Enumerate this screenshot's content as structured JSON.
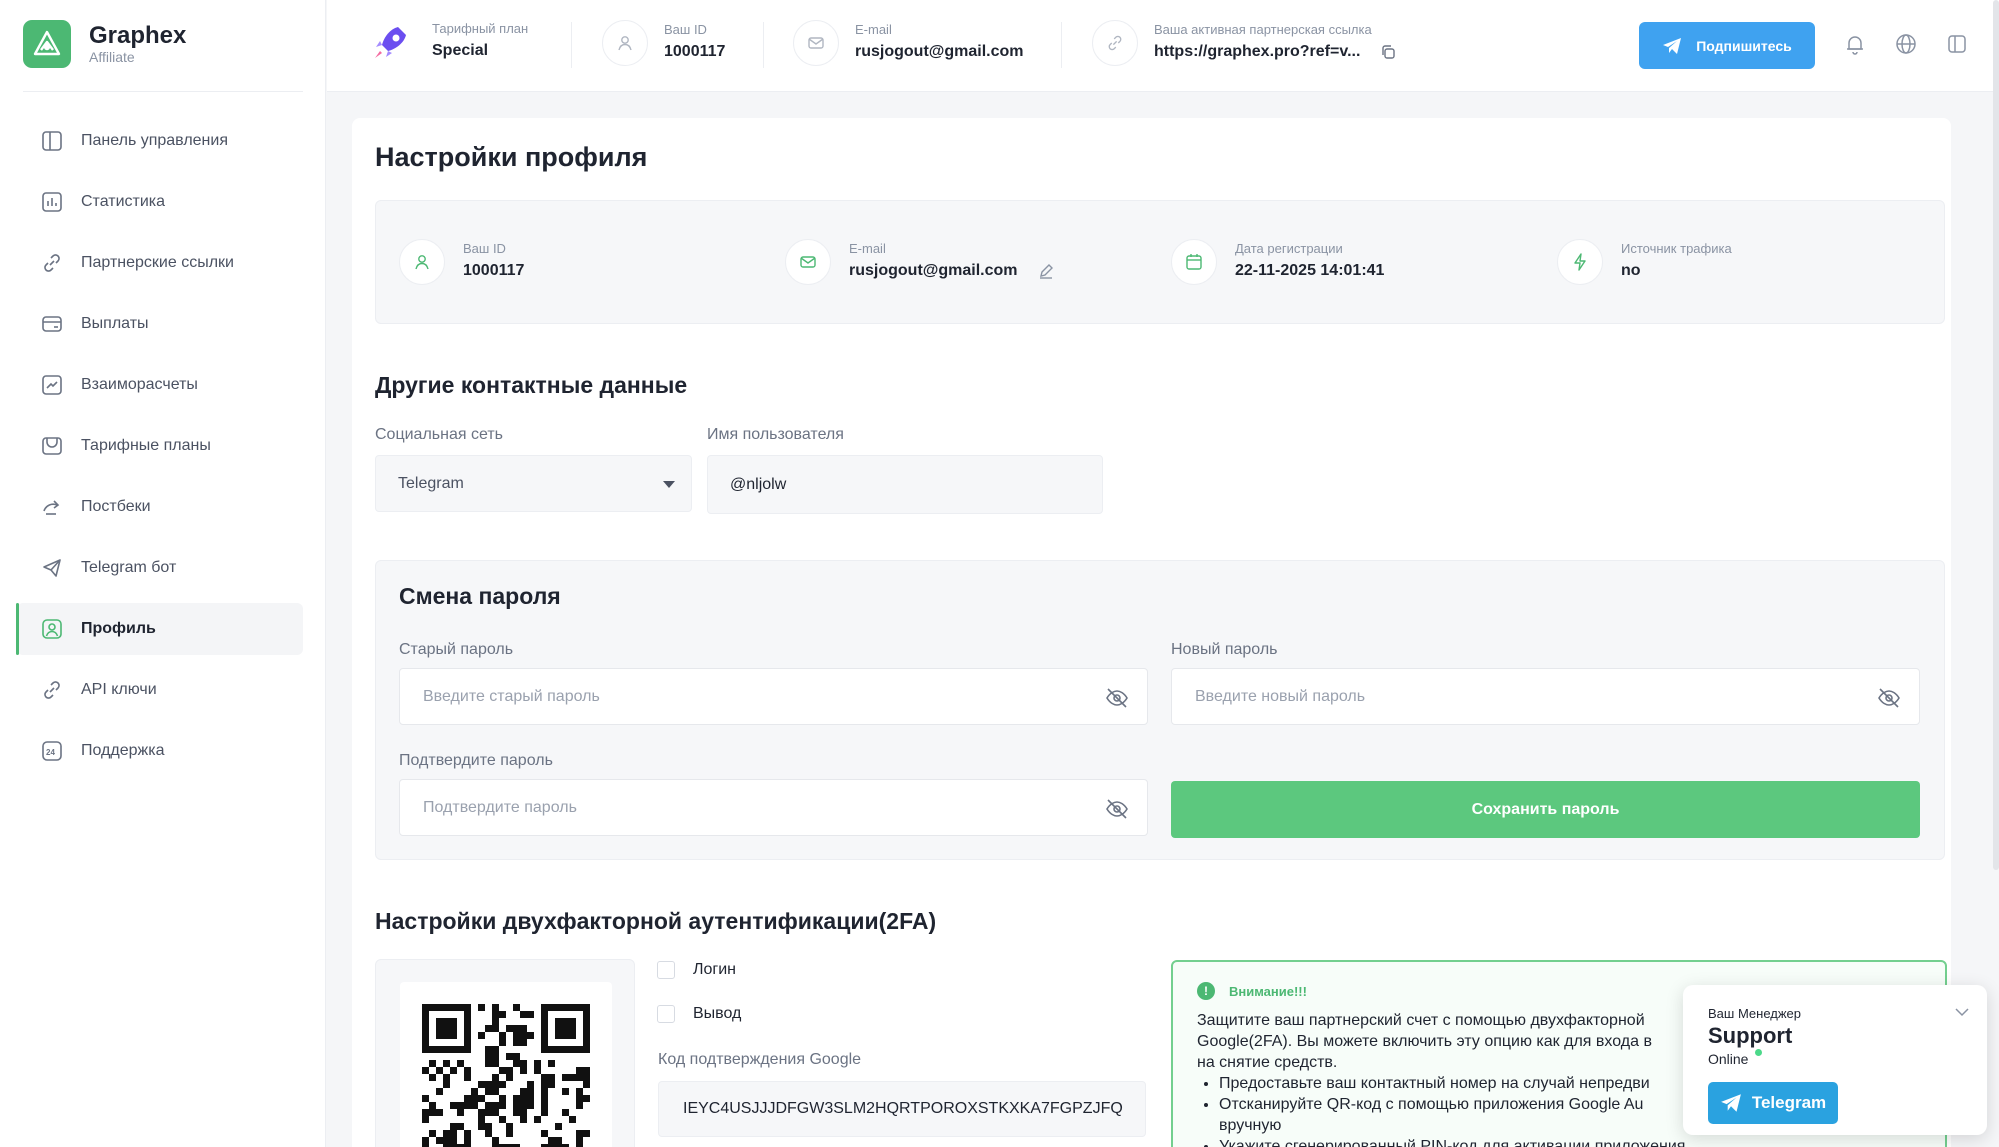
{
  "brand": {
    "name": "Graphex",
    "sub": "Affiliate",
    "color": "#4cb873"
  },
  "sidebar": {
    "items": [
      {
        "label": "Панель управления",
        "icon": "dashboard-icon"
      },
      {
        "label": "Статистика",
        "icon": "chart-icon"
      },
      {
        "label": "Партнерские ссылки",
        "icon": "link-icon"
      },
      {
        "label": "Выплаты",
        "icon": "wallet-icon"
      },
      {
        "label": "Взаиморасчеты",
        "icon": "trend-icon"
      },
      {
        "label": "Тарифные планы",
        "icon": "plans-icon"
      },
      {
        "label": "Постбеки",
        "icon": "postback-icon"
      },
      {
        "label": "Telegram бот",
        "icon": "telegram-icon"
      },
      {
        "label": "Профиль",
        "icon": "profile-icon",
        "active": true
      },
      {
        "label": "API ключи",
        "icon": "key-link-icon"
      },
      {
        "label": "Поддержка",
        "icon": "support-24-icon"
      }
    ]
  },
  "header": {
    "plan_label": "Тарифный план",
    "plan_value": "Special",
    "id_label": "Ваш ID",
    "id_value": "1000117",
    "email_label": "E-mail",
    "email_value": "rusjogout@gmail.com",
    "link_label": "Ваша активная партнерская ссылка",
    "link_value": "https://graphex.pro?ref=v...",
    "subscribe_label": "Подпишитесь",
    "accent": "#3fa2f0"
  },
  "profile": {
    "title": "Настройки профиля",
    "id_label": "Ваш ID",
    "id_value": "1000117",
    "email_label": "E-mail",
    "email_value": "rusjogout@gmail.com",
    "reg_label": "Дата регистрации",
    "reg_value": "22-11-2025 14:01:41",
    "source_label": "Источник трафика",
    "source_value": "no"
  },
  "contacts": {
    "title": "Другие контактные данные",
    "social_label": "Социальная сеть",
    "social_value": "Telegram",
    "username_label": "Имя пользователя",
    "username_value": "@nljolw"
  },
  "password": {
    "title": "Смена пароля",
    "old_label": "Старый пароль",
    "old_placeholder": "Введите старый пароль",
    "new_label": "Новый пароль",
    "new_placeholder": "Введите новый пароль",
    "confirm_label": "Подтвердите пароль",
    "confirm_placeholder": "Подтвердите пароль",
    "save_label": "Сохранить пароль",
    "save_color": "#5cc87e"
  },
  "twofa": {
    "title": "Настройки двухфакторной аутентификации(2FA)",
    "login_label": "Логин",
    "withdraw_label": "Вывод",
    "code_label": "Код подтверждения Google",
    "code_value": "IEYC4USJJJDFGW3SLM2HQRTPOROXSTKXKA7FGPZJFQ",
    "warn_title": "Внимание!!!",
    "warn_text_1": "Защитите ваш партнерский счет с помощью двухфакторной",
    "warn_text_2": "Google(2FA). Вы можете включить эту опцию как для входа в",
    "warn_text_3": "на снятие средств.",
    "warn_bullet_1": "Предоставьте ваш контактный номер на случай непредви",
    "warn_bullet_2": "Отсканируйте QR-код с помощью приложения Google Au",
    "warn_bullet_2b": "вручную",
    "warn_bullet_3": "Укажите сгенерированный PIN-код для активации приложения"
  },
  "support": {
    "label": "Ваш Менеджер",
    "name": "Support",
    "status": "Online",
    "button_label": "Telegram"
  }
}
